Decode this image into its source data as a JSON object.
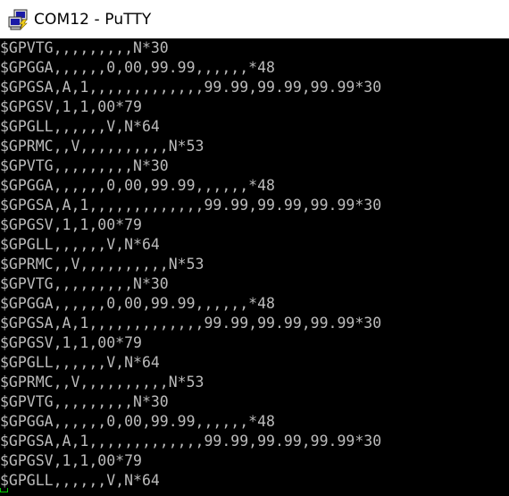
{
  "window": {
    "title": "COM12 - PuTTY",
    "app_icon": "putty-terminal-icon"
  },
  "terminal": {
    "foreground": "#bbbbbb",
    "background": "#000000",
    "cursor_color": "#00cc00",
    "lines": [
      "$GPVTG,,,,,,,,,N*30",
      "$GPGGA,,,,,,0,00,99.99,,,,,,*48",
      "$GPGSA,A,1,,,,,,,,,,,,,99.99,99.99,99.99*30",
      "$GPGSV,1,1,00*79",
      "$GPGLL,,,,,,V,N*64",
      "$GPRMC,,V,,,,,,,,,,N*53",
      "$GPVTG,,,,,,,,,N*30",
      "$GPGGA,,,,,,0,00,99.99,,,,,,*48",
      "$GPGSA,A,1,,,,,,,,,,,,,99.99,99.99,99.99*30",
      "$GPGSV,1,1,00*79",
      "$GPGLL,,,,,,V,N*64",
      "$GPRMC,,V,,,,,,,,,,N*53",
      "$GPVTG,,,,,,,,,N*30",
      "$GPGGA,,,,,,0,00,99.99,,,,,,*48",
      "$GPGSA,A,1,,,,,,,,,,,,,99.99,99.99,99.99*30",
      "$GPGSV,1,1,00*79",
      "$GPGLL,,,,,,V,N*64",
      "$GPRMC,,V,,,,,,,,,,N*53",
      "$GPVTG,,,,,,,,,N*30",
      "$GPGGA,,,,,,0,00,99.99,,,,,,*48",
      "$GPGSA,A,1,,,,,,,,,,,,,99.99,99.99,99.99*30",
      "$GPGSV,1,1,00*79",
      "$GPGLL,,,,,,V,N*64"
    ]
  }
}
